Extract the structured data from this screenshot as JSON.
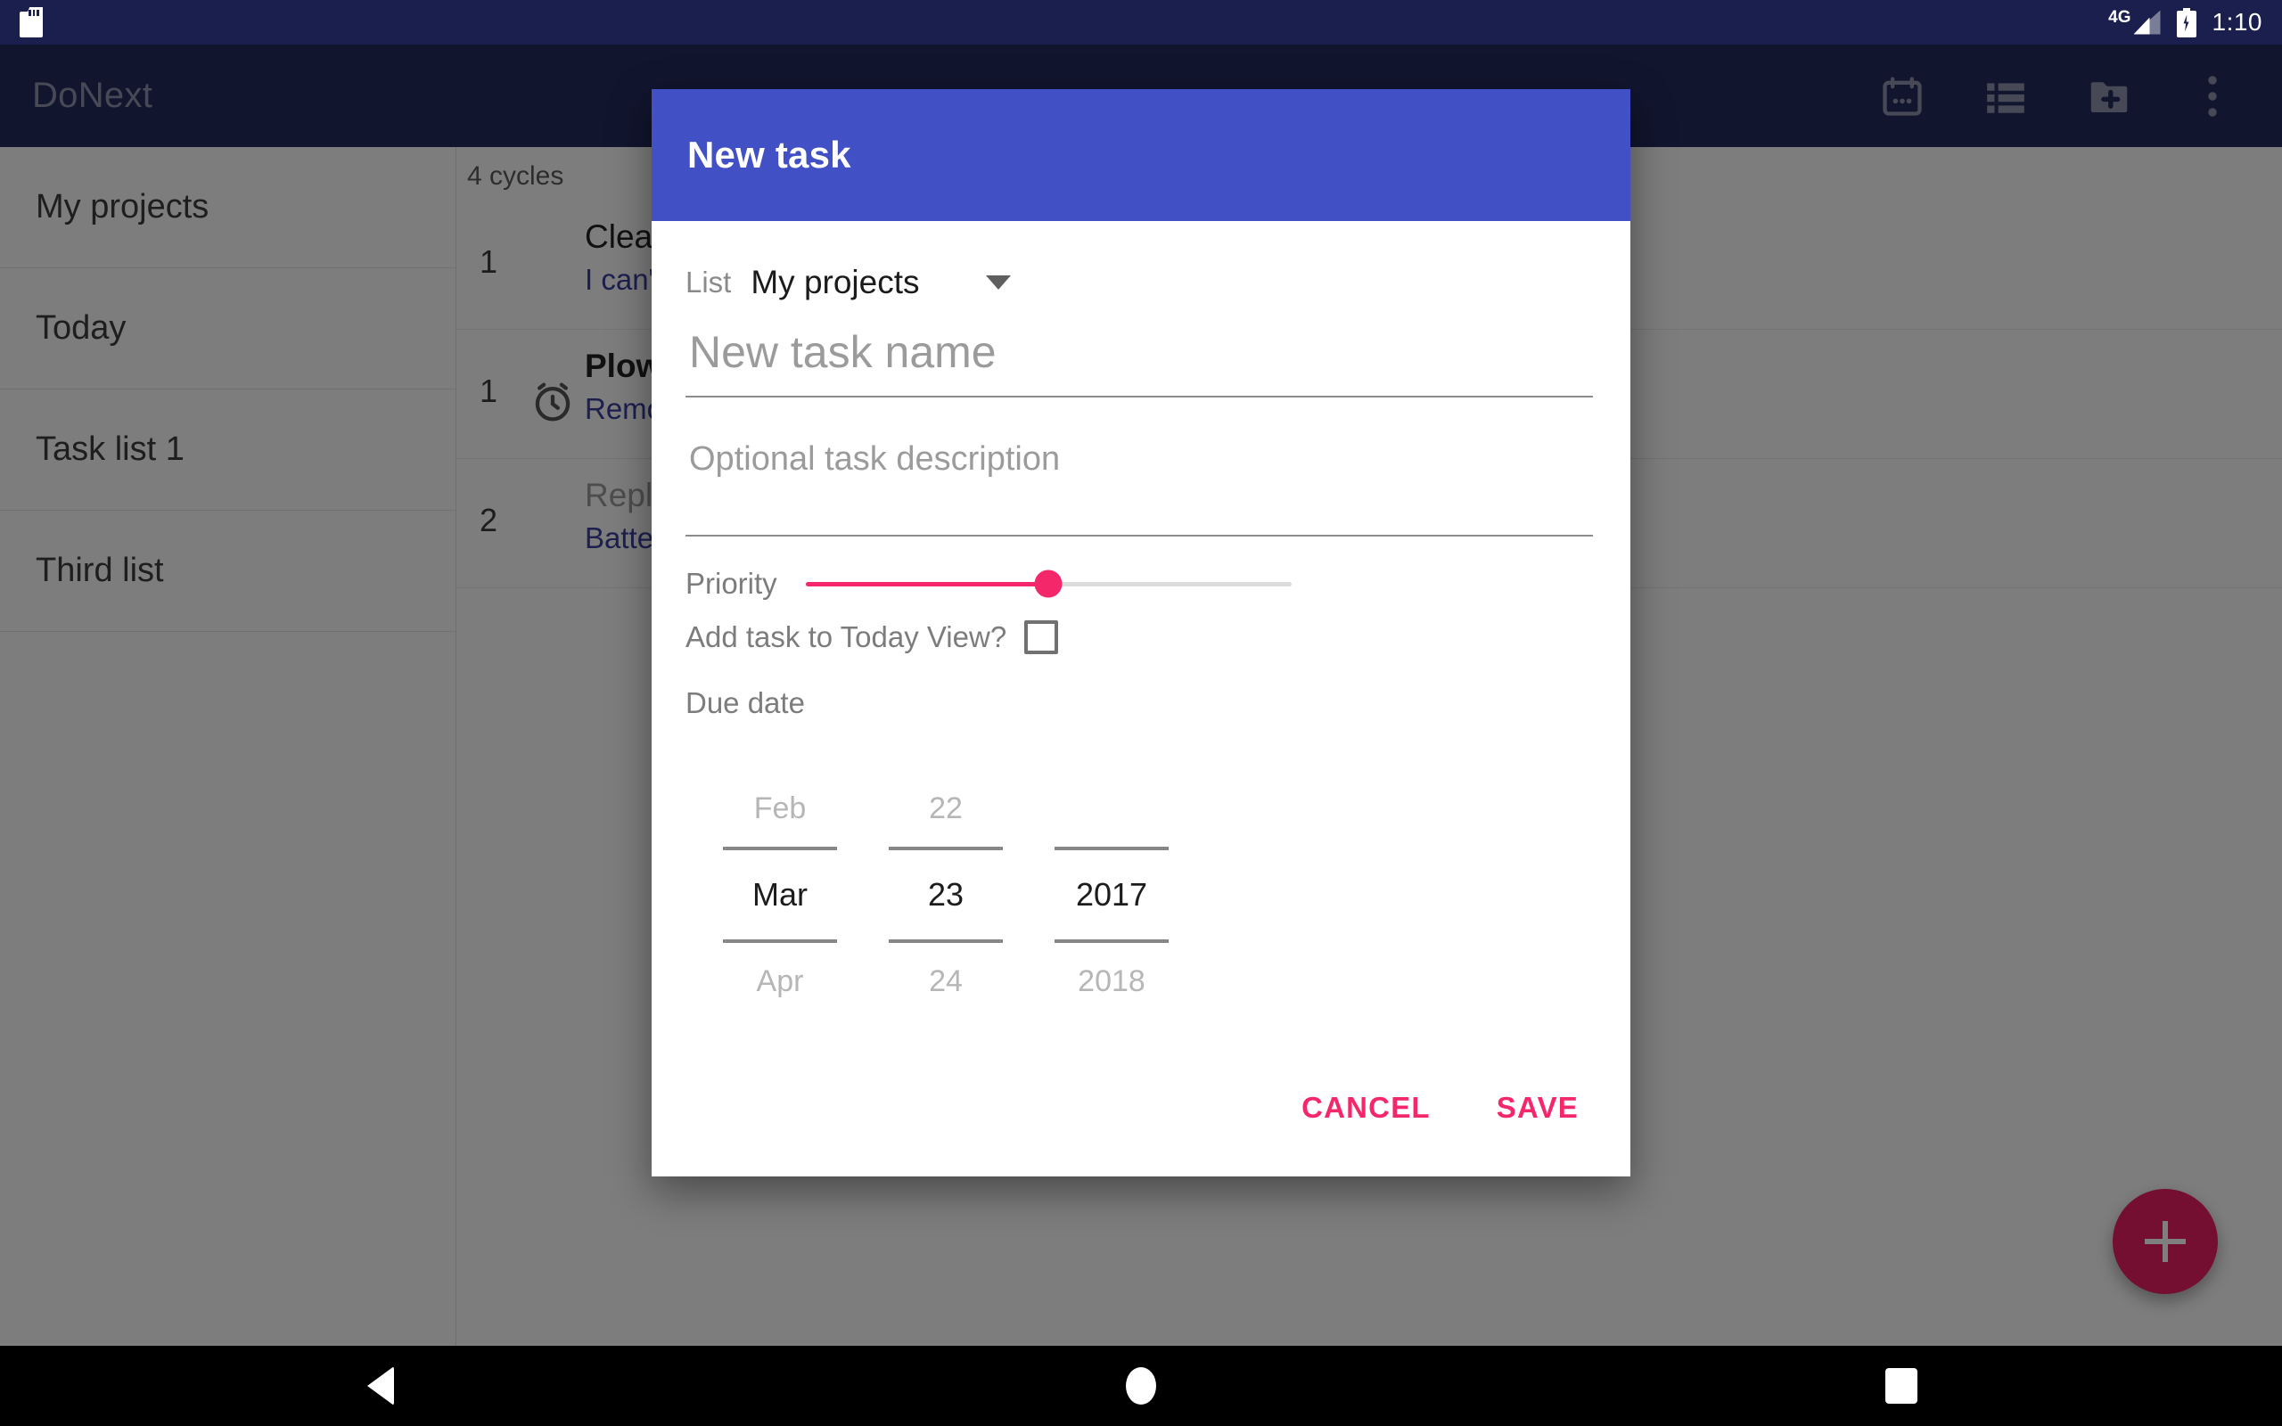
{
  "status_bar": {
    "sdcard_icon": "sdcard-icon",
    "network_label": "4G",
    "signal_icon": "signal-triangle-icon",
    "battery_icon": "battery-charging-icon",
    "clock": "1:10"
  },
  "app_bar": {
    "title": "DoNext",
    "actions": [
      {
        "name": "calendar-icon",
        "label": "Calendar"
      },
      {
        "name": "list-icon",
        "label": "List view"
      },
      {
        "name": "folder-add-icon",
        "label": "New list"
      },
      {
        "name": "overflow-menu-icon",
        "label": "More options"
      }
    ]
  },
  "sidebar": {
    "items": [
      {
        "label": "My projects"
      },
      {
        "label": "Today"
      },
      {
        "label": "Task list 1"
      },
      {
        "label": "Third list"
      }
    ]
  },
  "task_pane": {
    "cycles_label": "4 cycles",
    "rows": [
      {
        "count": "1",
        "title": "Clean ",
        "subtitle": "I can't s",
        "alarm": false,
        "bold": false,
        "muted": false
      },
      {
        "count": "1",
        "title": "Plow s",
        "subtitle": "Remove",
        "alarm": true,
        "bold": true,
        "muted": false
      },
      {
        "count": "2",
        "title": "Replac",
        "subtitle": "Battery",
        "alarm": false,
        "bold": false,
        "muted": true
      }
    ],
    "fab_label": "add-task"
  },
  "dialog": {
    "title": "New task",
    "list_label": "List",
    "list_value": "My projects",
    "task_name_placeholder": "New task name",
    "task_name_value": "",
    "description_placeholder": "Optional task description",
    "description_value": "",
    "priority_label": "Priority",
    "priority_percent": 50,
    "today_label": "Add task to Today View?",
    "today_checked": false,
    "due_date_label": "Due date",
    "date_picker": {
      "month": {
        "prev": "Feb",
        "current": "Mar",
        "next": "Apr"
      },
      "day": {
        "prev": "22",
        "current": "23",
        "next": "24"
      },
      "year": {
        "prev": "",
        "current": "2017",
        "next": "2018"
      }
    },
    "cancel_label": "CANCEL",
    "save_label": "SAVE"
  },
  "nav_bar": {
    "back": "back-icon",
    "home": "home-icon",
    "recents": "recents-icon"
  },
  "colors": {
    "status_bar": "#1a1f4d",
    "app_bar": "#232a5c",
    "dialog_header": "#4150c4",
    "accent_pink": "#f4276b",
    "link_blue": "#3b3f9e"
  }
}
